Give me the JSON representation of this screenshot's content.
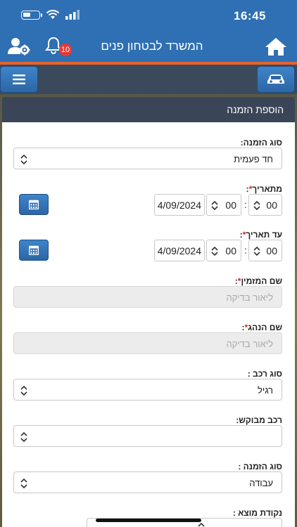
{
  "status": {
    "time": "16:45"
  },
  "header": {
    "title": "המשרד לבטחון פנים",
    "notification_count": "10"
  },
  "panel": {
    "title": "הוספת הזמנה"
  },
  "form": {
    "order_type_label": "סוג הזמנה:",
    "order_type_value": "חד פעמית",
    "from_date_label": "מתאריך",
    "from_date_value": "4/09/2024",
    "from_hour": "00",
    "from_minute": "00",
    "to_date_label": "עד תאריך",
    "to_date_value": "4/09/2024",
    "to_hour": "00",
    "to_minute": "00",
    "orderer_label": "שם המזמין",
    "orderer_placeholder": "ליאור בדיקה",
    "driver_label": "שם הנהג",
    "driver_placeholder": "ליאור בדיקה",
    "vehicle_type_label": "סוג רכב :",
    "vehicle_type_value": "רגיל",
    "requested_vehicle_label": "רכב מבוקש:",
    "requested_vehicle_value": "",
    "order_kind_label": "סוג הזמנה :",
    "order_kind_value": "עבודה",
    "origin_label": "נקודת מוצא :"
  },
  "required_mark": "*",
  "colon": ":",
  "colors": {
    "header": "#2f6fb3",
    "accent_line": "#e8622a",
    "toolbar": "#3a4a5c",
    "panel_header": "#3a4657",
    "required": "#d9232e"
  }
}
